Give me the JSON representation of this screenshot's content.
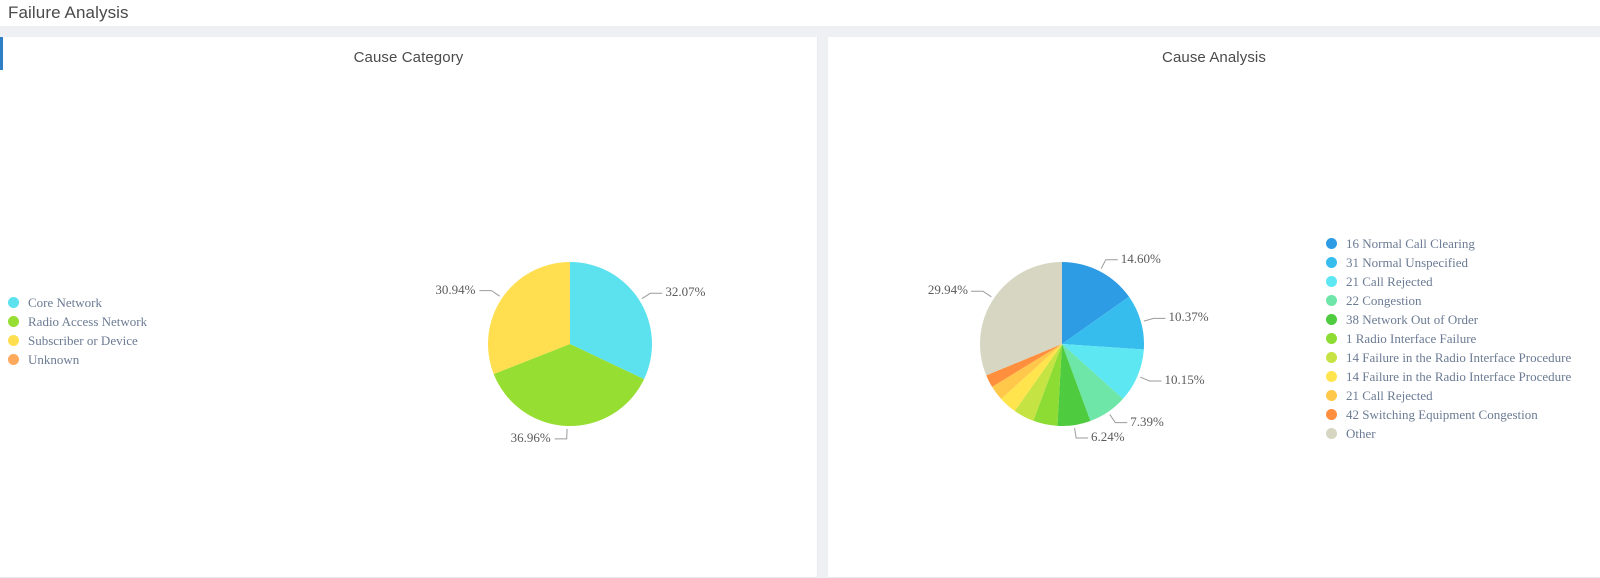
{
  "header": {
    "title": "Failure Analysis"
  },
  "panels": [
    {
      "title": "Cause Category",
      "legend_position": "left"
    },
    {
      "title": "Cause Analysis",
      "legend_position": "right"
    }
  ],
  "chart_data": [
    {
      "type": "pie",
      "title": "Cause Category",
      "legend_position": "left",
      "labels": [
        "Core Network",
        "Radio Access Network",
        "Subscriber or Device",
        "Unknown"
      ],
      "values": [
        32.07,
        36.96,
        30.94,
        0.03
      ],
      "value_labels": [
        "32.07%",
        "36.96%",
        "30.94%",
        ""
      ],
      "colors": [
        "#5ce1ee",
        "#97de32",
        "#ffdf50",
        "#ffa95c"
      ],
      "units": "percent"
    },
    {
      "type": "pie",
      "title": "Cause Analysis",
      "legend_position": "right",
      "labels": [
        "16 Normal Call Clearing",
        "31 Normal Unspecified",
        "21 Call Rejected",
        "22 Congestion",
        "38 Network Out of Order",
        "1 Radio Interface Failure",
        "14 Failure in the Radio Interface Procedure",
        "14 Failure in the Radio Interface Procedure",
        "21 Call Rejected",
        "42 Switching Equipment Congestion",
        "Other"
      ],
      "values": [
        14.6,
        10.37,
        10.15,
        7.39,
        6.24,
        4.6,
        3.9,
        3.4,
        2.8,
        2.4,
        29.94
      ],
      "value_labels": [
        "14.60%",
        "10.37%",
        "10.15%",
        "7.39%",
        "6.24%",
        "",
        "",
        "",
        "",
        "",
        "29.94%"
      ],
      "colors": [
        "#2e9ce5",
        "#36bdee",
        "#5ce7f3",
        "#6ee6a8",
        "#4ecb3e",
        "#8ddc33",
        "#c5e342",
        "#ffe44d",
        "#ffc84a",
        "#ff8f3c",
        "#d6d6c2"
      ],
      "units": "percent"
    }
  ],
  "colors": {
    "accent": "#2f7fc6",
    "panel_gap": "#eff0f4",
    "title_text": "#4b4b4b",
    "legend_text": "#6b7b93"
  }
}
